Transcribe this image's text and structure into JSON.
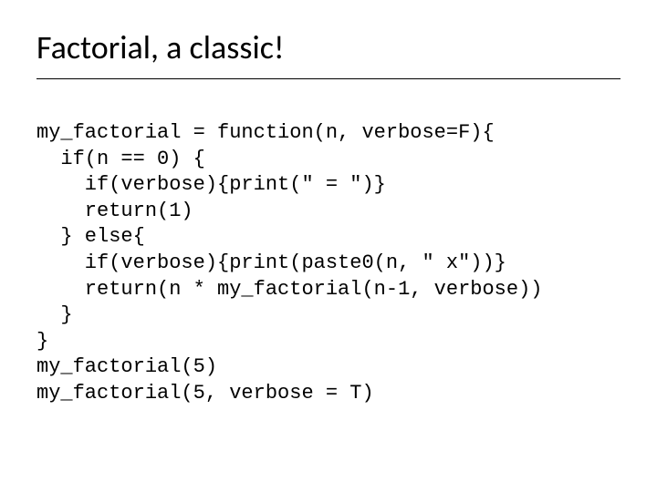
{
  "title": "Factorial, a classic!",
  "code": "my_factorial = function(n, verbose=F){\n  if(n == 0) {\n    if(verbose){print(\" = \")}\n    return(1)\n  } else{\n    if(verbose){print(paste0(n, \" x\"))}\n    return(n * my_factorial(n-1, verbose))\n  }\n}\nmy_factorial(5)\nmy_factorial(5, verbose = T)"
}
